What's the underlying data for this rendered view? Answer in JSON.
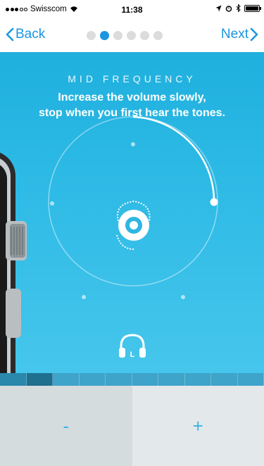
{
  "status_bar": {
    "carrier": "Swisscom",
    "time": "11:38",
    "signal_bars": 3,
    "battery_level": 1.0
  },
  "nav": {
    "back_label": "Back",
    "next_label": "Next",
    "page_count": 6,
    "current_page": 2
  },
  "main": {
    "subtitle": "MID FREQUENCY",
    "instruction_line1": "Increase the volume slowly,",
    "instruction_line2": "stop when you first hear the tones.",
    "headphone_side": "L",
    "volume_level": 0.26
  },
  "progress": {
    "total_segments": 10,
    "completed_segments": 1
  },
  "controls": {
    "minus_label": "-",
    "plus_label": "+"
  },
  "colors": {
    "accent": "#1b95e0",
    "main_bg": "#2fbbe6",
    "control_text": "#38b6de"
  }
}
